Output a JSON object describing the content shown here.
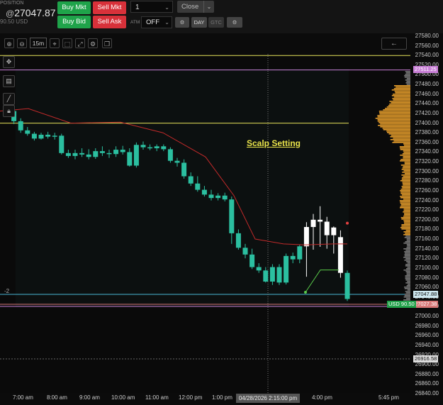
{
  "position": {
    "label": "POSITION",
    "price_prefix": "@",
    "price": "27047.87",
    "usd": "90.50 USD"
  },
  "order_buttons": {
    "buy_mkt": "Buy Mkt",
    "sell_mkt": "Sell Mkt",
    "buy_bid": "Buy Bid",
    "sell_ask": "Sell Ask"
  },
  "quantity": {
    "value": "1"
  },
  "close_button": {
    "label": "Close"
  },
  "atm": {
    "label": "ATM",
    "value": "OFF"
  },
  "tif": {
    "day": "DAY",
    "gtc": "GTC"
  },
  "toolbar": {
    "timeframe": "15m"
  },
  "chart_data": {
    "type": "candlestick",
    "annotation": "Scalp Setting",
    "position_qty_label": "-2",
    "current_price_tag": "27047.88",
    "pnl_tag": "USD 90.50",
    "pnl_price_tag": "27027.38",
    "top_price_tag": "27511.25",
    "lower_level_tag": "26916.58",
    "y_ticks": [
      "27580.00",
      "27560.00",
      "27540.00",
      "27520.00",
      "27500.00",
      "27480.00",
      "27460.00",
      "27440.00",
      "27420.00",
      "27400.00",
      "27380.00",
      "27360.00",
      "27340.00",
      "27320.00",
      "27300.00",
      "27280.00",
      "27260.00",
      "27240.00",
      "27220.00",
      "27200.00",
      "27180.00",
      "27160.00",
      "27140.00",
      "27120.00",
      "27100.00",
      "27080.00",
      "27060.00",
      "27040.00",
      "27020.00",
      "27000.00",
      "26980.00",
      "26960.00",
      "26940.00",
      "26920.00",
      "26900.00",
      "26880.00",
      "26860.00",
      "26840.00"
    ],
    "x_ticks": [
      "7:00 am",
      "8:00 am",
      "9:00 am",
      "10:00 am",
      "11:00 am",
      "12:00 pm",
      "1:00 pm",
      "4:00 pm",
      "5:45 pm"
    ],
    "crosshair_time": "04/28/2026 2:15:00 pm",
    "levels": [
      27540,
      27510,
      27400
    ],
    "candles": [
      [
        27436,
        27444,
        27418,
        27425
      ],
      [
        27425,
        27430,
        27398,
        27404
      ],
      [
        27404,
        27410,
        27380,
        27385
      ],
      [
        27385,
        27392,
        27374,
        27378
      ],
      [
        27378,
        27382,
        27364,
        27368
      ],
      [
        27368,
        27380,
        27366,
        27376
      ],
      [
        27376,
        27382,
        27368,
        27372
      ],
      [
        27372,
        27380,
        27366,
        27374
      ],
      [
        27374,
        27378,
        27335,
        27338
      ],
      [
        27338,
        27345,
        27328,
        27332
      ],
      [
        27332,
        27345,
        27325,
        27338
      ],
      [
        27338,
        27348,
        27330,
        27335
      ],
      [
        27335,
        27346,
        27325,
        27330
      ],
      [
        27330,
        27348,
        27326,
        27342
      ],
      [
        27342,
        27352,
        27332,
        27338
      ],
      [
        27338,
        27345,
        27328,
        27336
      ],
      [
        27336,
        27352,
        27330,
        27345
      ],
      [
        27345,
        27353,
        27335,
        27340
      ],
      [
        27340,
        27348,
        27310,
        27312
      ],
      [
        27312,
        27360,
        27308,
        27355
      ],
      [
        27355,
        27362,
        27345,
        27350
      ],
      [
        27350,
        27356,
        27344,
        27348
      ],
      [
        27348,
        27356,
        27342,
        27352
      ],
      [
        27352,
        27356,
        27342,
        27346
      ],
      [
        27346,
        27350,
        27318,
        27322
      ],
      [
        27322,
        27328,
        27310,
        27318
      ],
      [
        27318,
        27325,
        27285,
        27290
      ],
      [
        27290,
        27298,
        27270,
        27275
      ],
      [
        27275,
        27290,
        27258,
        27262
      ],
      [
        27262,
        27270,
        27248,
        27252
      ],
      [
        27252,
        27262,
        27240,
        27245
      ],
      [
        27245,
        27255,
        27240,
        27250
      ],
      [
        27250,
        27256,
        27238,
        27242
      ],
      [
        27242,
        27248,
        27150,
        27172
      ],
      [
        27172,
        27180,
        27138,
        27142
      ],
      [
        27142,
        27150,
        27120,
        27128
      ],
      [
        27128,
        27140,
        27098,
        27102
      ],
      [
        27102,
        27110,
        27090,
        27095
      ],
      [
        27095,
        27102,
        27070,
        27072
      ],
      [
        27072,
        27108,
        27065,
        27102
      ],
      [
        27102,
        27108,
        27065,
        27070
      ],
      [
        27070,
        27130,
        27066,
        27125
      ],
      [
        27125,
        27132,
        27110,
        27118
      ],
      [
        27118,
        27148,
        27110,
        27145
      ],
      [
        27145,
        27195,
        27082,
        27185
      ],
      [
        27185,
        27212,
        27138,
        27200
      ],
      [
        27200,
        27228,
        27144,
        27196
      ],
      [
        27196,
        27206,
        27140,
        27168
      ],
      [
        27168,
        27186,
        27130,
        27184
      ],
      [
        27164,
        27178,
        27080,
        27090
      ],
      [
        27090,
        27095,
        27032,
        27036
      ]
    ],
    "volume_profile": "orange and grey histogram along right edge"
  }
}
